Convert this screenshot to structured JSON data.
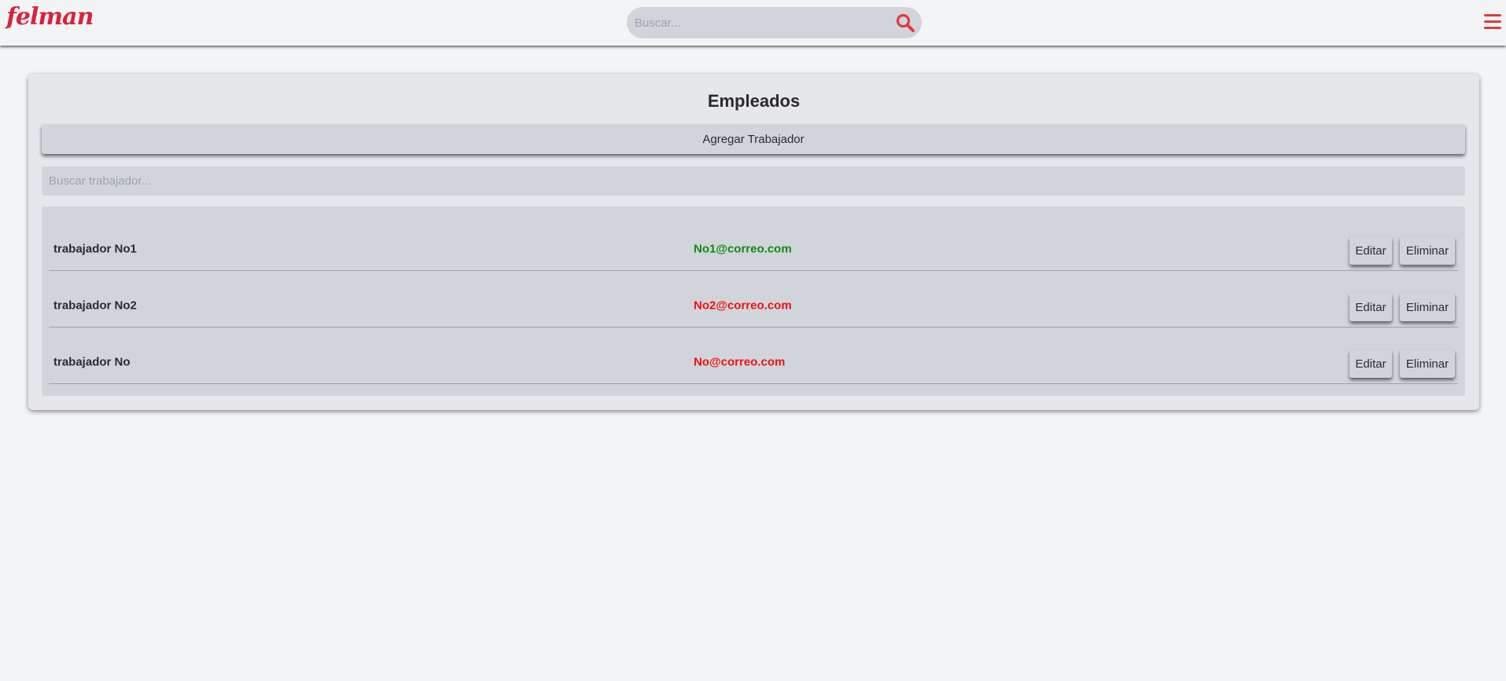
{
  "header": {
    "logo_text": "felman",
    "search_placeholder": "Buscar...",
    "search_icon": "search-icon",
    "menu_icon": "hamburger-menu-icon"
  },
  "card": {
    "title": "Empleados",
    "add_button_label": "Agregar Trabajador",
    "filter_placeholder": "Buscar trabajador..."
  },
  "workers": [
    {
      "name": "trabajador No1",
      "email": "No1@correo.com",
      "email_color": "#108a10",
      "edit_label": "Editar",
      "delete_label": "Eliminar"
    },
    {
      "name": "trabajador No2",
      "email": "No2@correo.com",
      "email_color": "#ee1111",
      "edit_label": "Editar",
      "delete_label": "Eliminar"
    },
    {
      "name": "trabajador No",
      "email": "No@correo.com",
      "email_color": "#ee1111",
      "edit_label": "Editar",
      "delete_label": "Eliminar"
    }
  ],
  "colors": {
    "brand": "#d9233a",
    "accent": "#e03b3b",
    "email_active": "#108a10",
    "email_inactive": "#ee1111"
  }
}
